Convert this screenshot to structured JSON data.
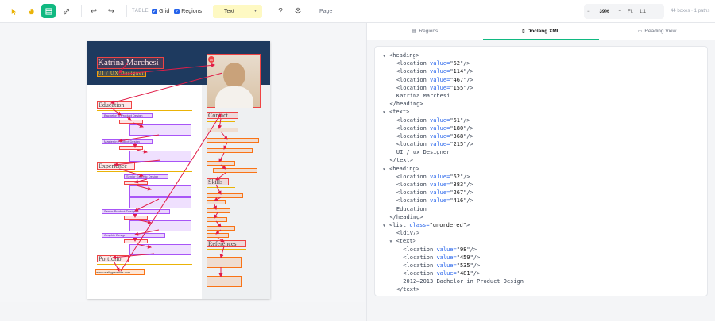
{
  "toolbar": {
    "icons": [
      "cursor-icon",
      "hand-icon",
      "table-icon",
      "link-icon",
      "undo-icon",
      "redo-icon",
      "help-icon",
      "gear-icon"
    ],
    "table_label": "TABLE",
    "grid_label": "Grid",
    "regions_label": "Regions",
    "label_select": "Text",
    "page_label": "Page",
    "zoom_value": "39%",
    "zoom_minus": "−",
    "zoom_plus": "+",
    "fit_label": "Fit",
    "one_to_one": "1:1",
    "counts": "44 boxes · 1 paths"
  },
  "document": {
    "name": "Katrina Marchesi",
    "role": "UI / UX Designer",
    "sections": {
      "education": "Education",
      "experience": "Experience",
      "portfolio": "Portfolio",
      "contact": "Contact",
      "skills": "Skills",
      "references": "References"
    },
    "education_items": [
      "Bachelor in Product Design",
      "Master in Product Design"
    ],
    "experience_items": [
      "Senior Graphic Design",
      "Senior Product Designer",
      "Graphic Design"
    ],
    "website": "www.reallygreatsite.com",
    "photo_badge": "10"
  },
  "tabs": [
    {
      "icon": "▤",
      "label": "Regions"
    },
    {
      "icon": "▯",
      "label": "Doclang XML"
    },
    {
      "icon": "▭",
      "label": "Reading View"
    }
  ],
  "xml": {
    "t1": "<heading>",
    "t1_l1": "62",
    "t1_l2": "114",
    "t1_l3": "467",
    "t1_l4": "155",
    "t1_text": "Katrina Marchesi",
    "t1_close": "</heading>",
    "t2": "<text>",
    "t2_l1": "61",
    "t2_l2": "180",
    "t2_l3": "368",
    "t2_l4": "215",
    "t2_text": "UI / ux Designer",
    "t2_close": "</text>",
    "t3": "<heading>",
    "t3_l1": "62",
    "t3_l2": "383",
    "t3_l3": "267",
    "t3_l4": "416",
    "t3_text": "Education",
    "t3_close": "</heading>",
    "t4_open": "<list ",
    "t4_attr": "class=",
    "t4_val": "\"unordered\"",
    "t4_end": ">",
    "t4_div": "<ldiv/>",
    "t5": "<text>",
    "t5_l1": "98",
    "t5_l2": "459",
    "t5_l3": "535",
    "t5_l4": "481",
    "t5_text": "2012–2013 Bachelor in Product Design",
    "t5_close": "</text>",
    "loc_open": "<location ",
    "loc_attr": "value=",
    "loc_close": "/>"
  }
}
